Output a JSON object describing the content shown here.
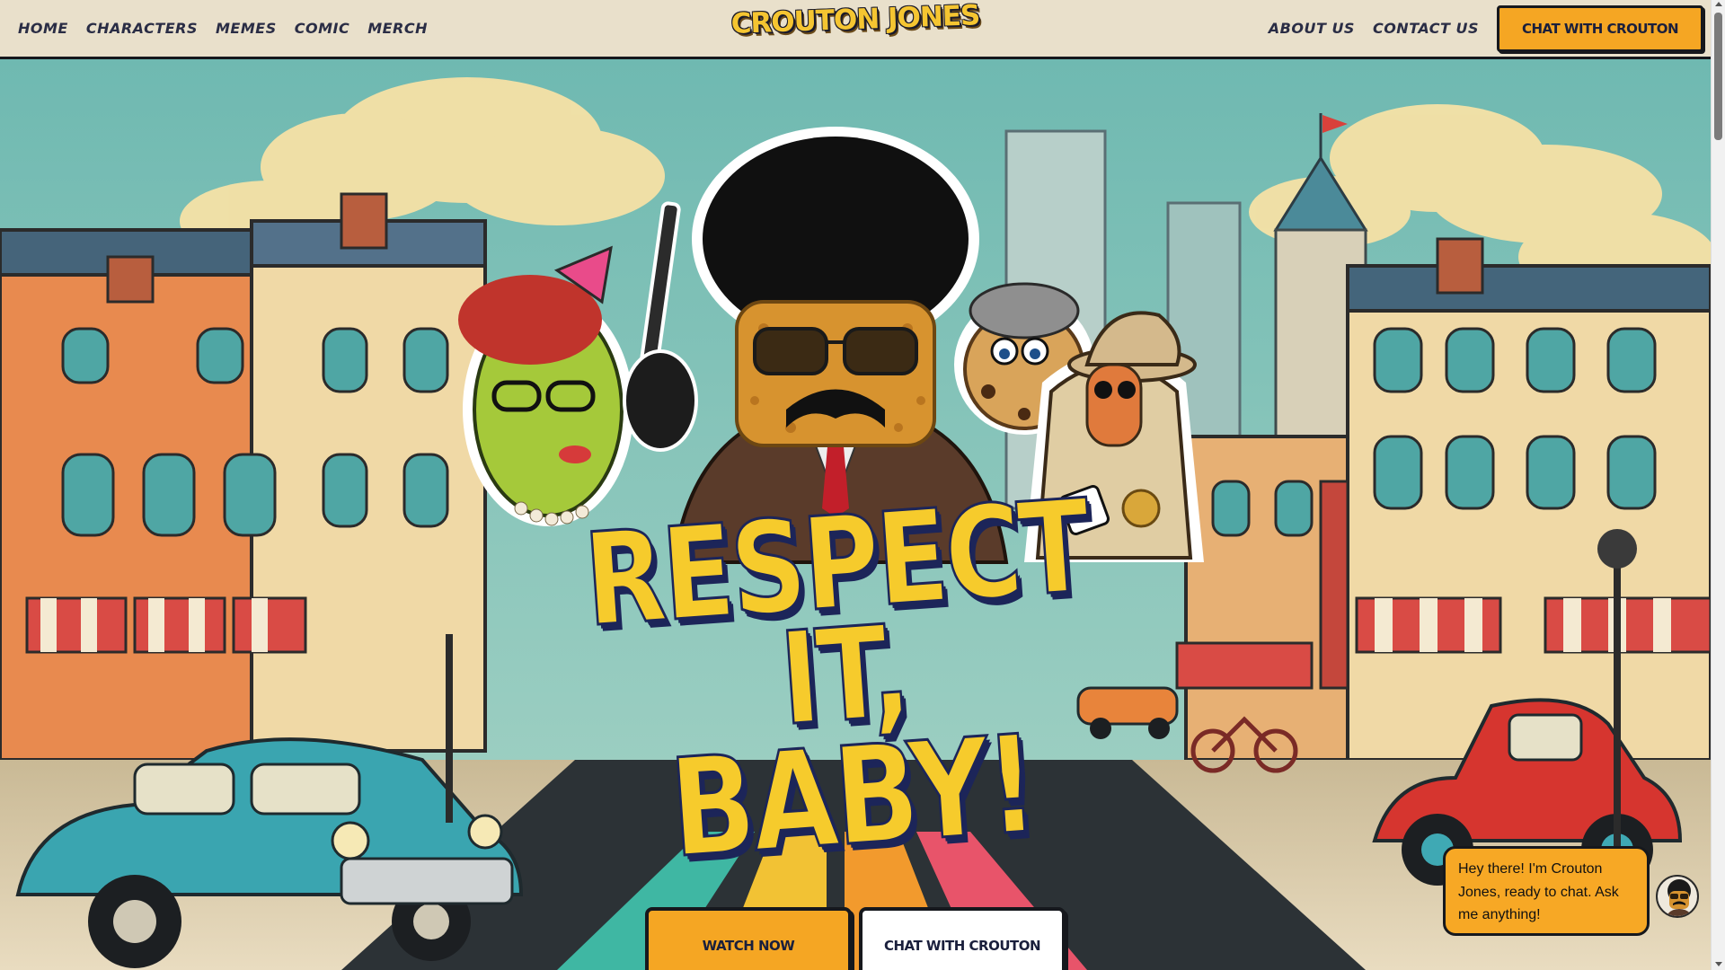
{
  "nav": {
    "left_links": [
      "HOME",
      "CHARACTERS",
      "MEMES",
      "COMIC",
      "MERCH"
    ],
    "logo_text": "CROUTON JONES",
    "right_links": [
      "ABOUT US",
      "CONTACT US"
    ],
    "cta_label": "CHAT WITH CROUTON"
  },
  "hero": {
    "headline_line1": "RESPECT IT,",
    "headline_line2": "BABY!",
    "primary_button": "WATCH NOW",
    "secondary_button": "CHAT WITH CROUTON"
  },
  "chat_widget": {
    "message": "Hey there! I'm Crouton Jones, ready to chat. Ask me anything!"
  },
  "colors": {
    "nav_bg": "#e9e0cb",
    "accent_orange": "#f5a623",
    "headline_yellow": "#f6cb2c",
    "headline_outline": "#1c2559",
    "sky": "#7fc4bb"
  }
}
